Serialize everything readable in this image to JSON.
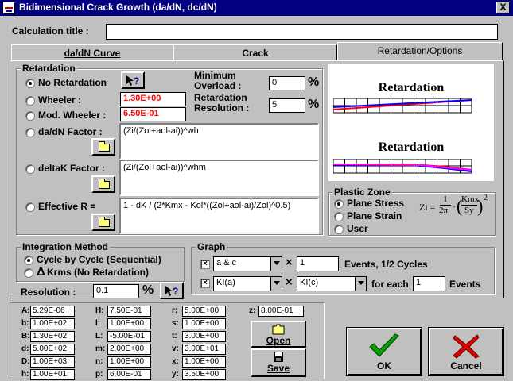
{
  "window": {
    "title": "Bidimensional Crack Growth (da/dN, dc/dN)",
    "close_label": "X"
  },
  "calc_title": {
    "label": "Calculation title :",
    "value": ""
  },
  "tabs": [
    {
      "label": "da/dN Curve"
    },
    {
      "label": "Crack"
    },
    {
      "label": "Retardation/Options"
    }
  ],
  "retardation": {
    "group_label": "Retardation",
    "no_retardation": "No Retardation",
    "wheeler": "Wheeler :",
    "wheeler_value": "1.30E+00",
    "mod_wheeler": "Mod. Wheeler :",
    "mod_wheeler_value": "6.50E-01",
    "dadn_factor": "da/dN Factor :",
    "dadn_factor_value": "(Zi/(Zol+aol-ai))^wh",
    "deltak_factor": "deltaK Factor :",
    "deltak_factor_value": "(Zi/(Zol+aol-ai))^whm",
    "effective_r": "Effective R =",
    "effective_r_value": "1 - dK / (2*Kmx - Kol*((Zol+aol-ai)/Zol)^0.5)",
    "min_overload_label_1": "Minimum",
    "min_overload_label_2": "Overload :",
    "min_overload_value": "0",
    "resolution_label_1": "Retardation",
    "resolution_label_2": "Resolution :",
    "resolution_value": "5",
    "percent": "%",
    "help_icon_text": "?"
  },
  "previews": [
    {
      "title": "Retardation"
    },
    {
      "title": "Retardation"
    }
  ],
  "plastic_zone": {
    "group_label": "Plastic Zone",
    "options": [
      "Plane Stress",
      "Plane Strain",
      "User"
    ],
    "formula_zi": "Zi =",
    "formula_num": "1",
    "formula_den": "2π",
    "formula_dot": "·",
    "formula_kmx": "Kmx",
    "formula_sy": "Sy",
    "formula_exp": "2"
  },
  "integration": {
    "group_label": "Integration Method",
    "options": [
      "Cycle by Cycle (Sequential)",
      "Krms (No Retardation)"
    ],
    "delta_symbol": "Δ",
    "resolution_label": "Resolution :",
    "resolution_value": "0.1",
    "percent": "%"
  },
  "graph": {
    "group_label": "Graph",
    "row1": {
      "check_mark": "×",
      "combo": "a & c",
      "mult": "×",
      "value": "1",
      "label": "Events, 1/2 Cycles"
    },
    "row2": {
      "check_mark": "×",
      "combo1": "KI(a)",
      "mult": "×",
      "combo2": "KI(c)",
      "for_each": "for each",
      "value": "1",
      "label": "Events"
    }
  },
  "params": {
    "col1": [
      {
        "name": "A:",
        "value": "5.29E-06"
      },
      {
        "name": "b:",
        "value": "1.00E+02"
      },
      {
        "name": "B:",
        "value": "1.30E+02"
      },
      {
        "name": "d:",
        "value": "5.00E+02"
      },
      {
        "name": "D:",
        "value": "1.00E+03"
      },
      {
        "name": "h:",
        "value": "1.00E+01"
      }
    ],
    "col2": [
      {
        "name": "H:",
        "value": "7.50E-01"
      },
      {
        "name": "l:",
        "value": "1.00E+00"
      },
      {
        "name": "L:",
        "value": "-5.00E-01"
      },
      {
        "name": "m:",
        "value": "2.00E+00"
      },
      {
        "name": "n:",
        "value": "1.00E+00"
      },
      {
        "name": "p:",
        "value": "6.00E-01"
      }
    ],
    "col3": [
      {
        "name": "r:",
        "value": "5.00E+00"
      },
      {
        "name": "s:",
        "value": "1.00E+00"
      },
      {
        "name": "t:",
        "value": "3.00E+00"
      },
      {
        "name": "v:",
        "value": "3.00E+01"
      },
      {
        "name": "x:",
        "value": "1.00E+00"
      },
      {
        "name": "y:",
        "value": "3.50E+00"
      }
    ],
    "z": {
      "name": "z:",
      "value": "8.00E-01"
    }
  },
  "buttons": {
    "open": "Open",
    "save": "Save",
    "ok": "OK",
    "cancel": "Cancel"
  },
  "colors": {
    "title_bar": "#000080",
    "red_value": "#ff0000",
    "ok_check": "#00a000",
    "cancel_x": "#e00000"
  }
}
